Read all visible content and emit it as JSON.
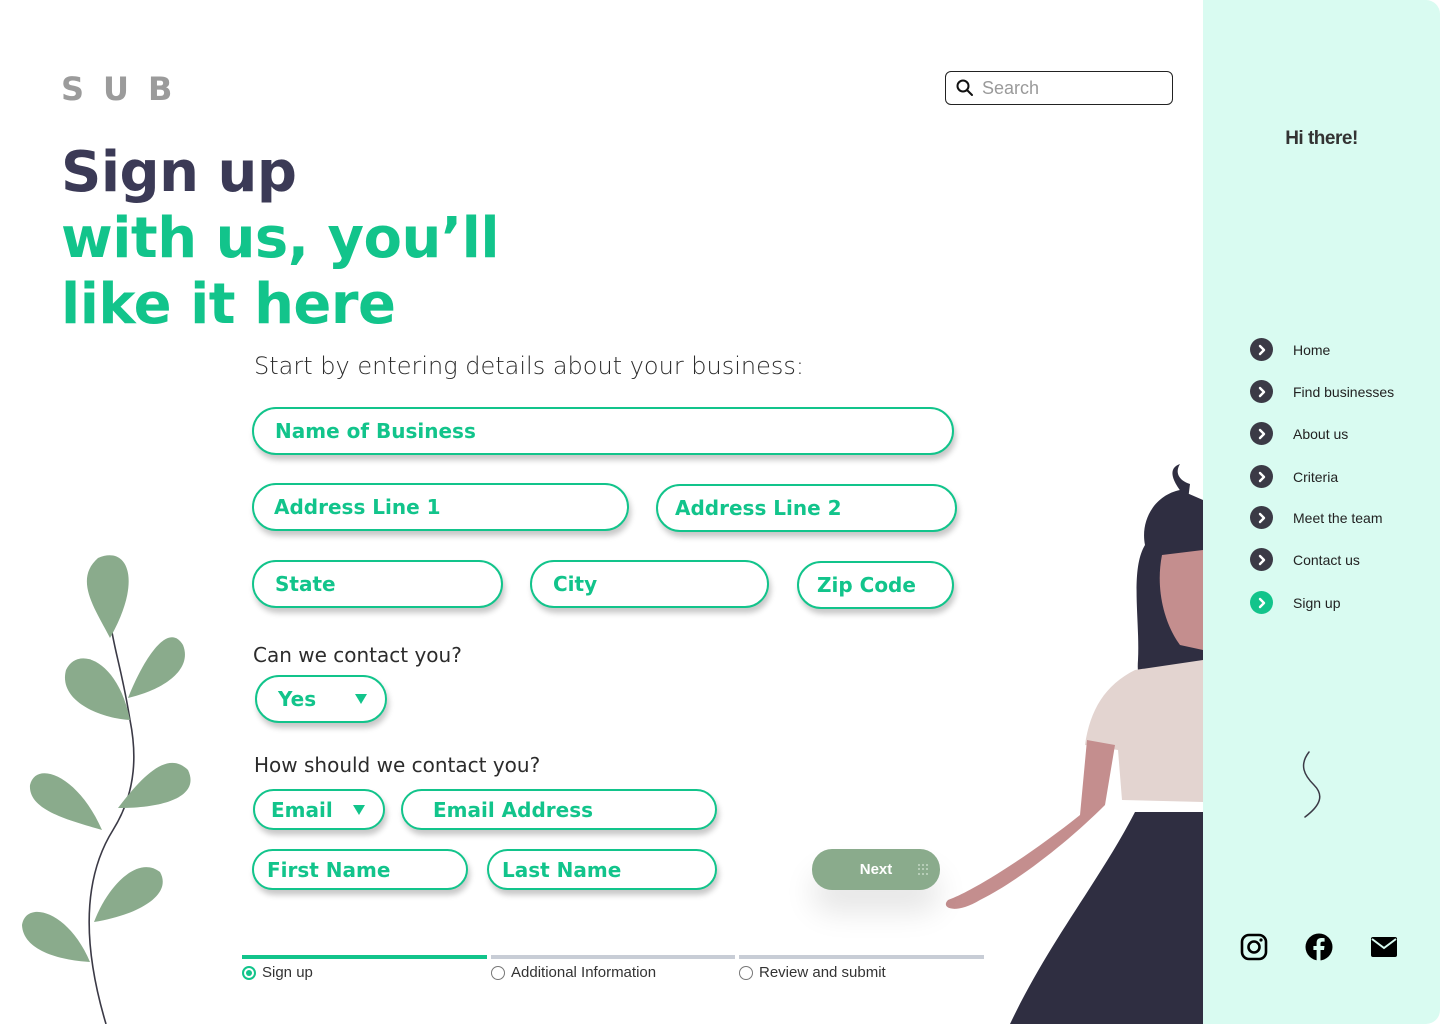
{
  "header": {
    "logo": "SUB",
    "search_placeholder": "Search"
  },
  "hero": {
    "line1": "Sign up",
    "line2": "with us, you’ll",
    "line3": "like it here"
  },
  "form": {
    "lead": "Start by entering details about your business:",
    "name_of_business": "Name of Business",
    "address_line_1": "Address Line 1",
    "address_line_2": "Address Line 2",
    "state": "State",
    "city": "City",
    "zip_code": "Zip Code",
    "contact_question": "Can we contact you?",
    "contact_answer": "Yes",
    "method_question": "How should we contact you?",
    "method_answer": "Email",
    "email_address": "Email Address",
    "first_name": "First Name",
    "last_name": "Last Name",
    "next_label": "Next"
  },
  "progress": {
    "steps": [
      {
        "label": "Sign up",
        "active": true
      },
      {
        "label": "Additional Information",
        "active": false
      },
      {
        "label": "Review and submit",
        "active": false
      }
    ]
  },
  "sidebar": {
    "greeting": "Hi there!",
    "items": [
      {
        "label": "Home",
        "icon": "chevron-right-icon"
      },
      {
        "label": "Find businesses",
        "icon": "chevron-right-icon"
      },
      {
        "label": "About us",
        "icon": "chevron-right-icon"
      },
      {
        "label": "Criteria",
        "icon": "chevron-right-icon"
      },
      {
        "label": "Meet the team",
        "icon": "chevron-right-icon"
      },
      {
        "label": "Contact us",
        "icon": "chevron-right-icon"
      },
      {
        "label": "Sign up",
        "icon": "chevron-right-icon",
        "active": true
      }
    ],
    "social": [
      "instagram-icon",
      "facebook-icon",
      "mail-icon"
    ]
  },
  "colors": {
    "accent": "#12c48b",
    "sidebar_bg": "#d9fbf1",
    "heading_dark": "#3b3a56",
    "next_button": "#8aab8c",
    "leaf": "#8aab8c"
  }
}
